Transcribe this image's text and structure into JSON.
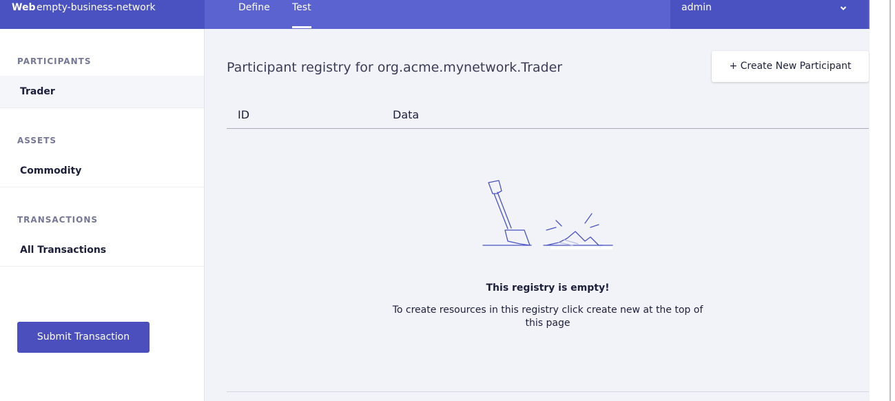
{
  "header": {
    "brand": "Web",
    "network_name": "empty-business-network",
    "tabs": [
      {
        "label": "Define"
      },
      {
        "label": "Test"
      }
    ],
    "user": "admin"
  },
  "sidebar": {
    "sections": [
      {
        "title": "PARTICIPANTS",
        "items": [
          {
            "label": "Trader"
          }
        ]
      },
      {
        "title": "ASSETS",
        "items": [
          {
            "label": "Commodity"
          }
        ]
      },
      {
        "title": "TRANSACTIONS",
        "items": [
          {
            "label": "All Transactions"
          }
        ]
      }
    ],
    "submit_label": "Submit Transaction"
  },
  "main": {
    "title": "Participant registry for org.acme.mynetwork.Trader",
    "create_label": "+ Create New Participant",
    "columns": [
      "ID",
      "Data"
    ],
    "empty_title": "This registry is empty!",
    "empty_desc": "To create resources in this registry click create new at the top of this page"
  },
  "icons": {
    "user_menu": "chevron-down-icon",
    "empty_state": "shovel-illustration"
  },
  "colors": {
    "header": "#5b63d0",
    "header_dark": "#4a52c2",
    "primary_button": "#4a4fbd",
    "background": "#f2f3f8"
  }
}
